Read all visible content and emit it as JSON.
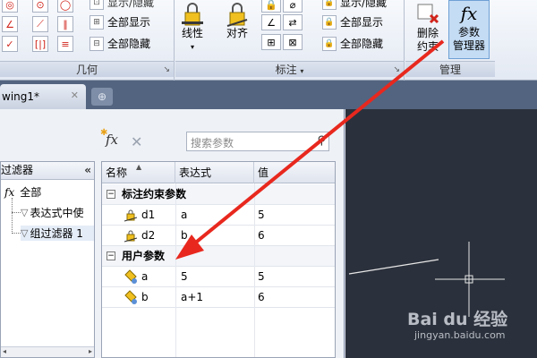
{
  "ribbon": {
    "geometry_panel": {
      "title": "几何",
      "show_all_label": "全部显示",
      "hide_all_label": "全部隐藏"
    },
    "annotate_panel": {
      "title": "标注",
      "linear_label": "线性",
      "aligned_label": "对齐",
      "show_hide_label": "显示/隐藏",
      "show_all_label": "全部显示",
      "hide_all_label": "全部隐藏"
    },
    "manage_panel": {
      "title": "管理",
      "delete_constraints_line1": "删除",
      "delete_constraints_line2": "约束",
      "param_manager_icon_text": "fx",
      "param_manager_line1": "参数",
      "param_manager_line2": "管理器"
    }
  },
  "tabs": {
    "drawing_tab_label": "wing1*"
  },
  "param_manager": {
    "fx_text": "fx",
    "search_placeholder": "搜索参数",
    "filter": {
      "header": "过滤器",
      "all_label": "全部",
      "items": [
        "表达式中使",
        "组过滤器 1"
      ]
    },
    "columns": {
      "name": "名称",
      "expression": "表达式",
      "value": "值"
    },
    "groups": [
      {
        "label": "标注约束参数",
        "rows": [
          {
            "name": "d1",
            "expression": "a",
            "value": "5"
          },
          {
            "name": "d2",
            "expression": "b",
            "value": "6"
          }
        ]
      },
      {
        "label": "用户参数",
        "rows": [
          {
            "name": "a",
            "expression": "5",
            "value": "5"
          },
          {
            "name": "b",
            "expression": "a+1",
            "value": "6"
          }
        ]
      }
    ]
  },
  "watermark": {
    "logo_text": "Bai du 经验",
    "url": "jingyan.baidu.com"
  },
  "colors": {
    "arrow": "#e8281e",
    "canvas": "#2b313c",
    "tab_bar": "#536480"
  }
}
